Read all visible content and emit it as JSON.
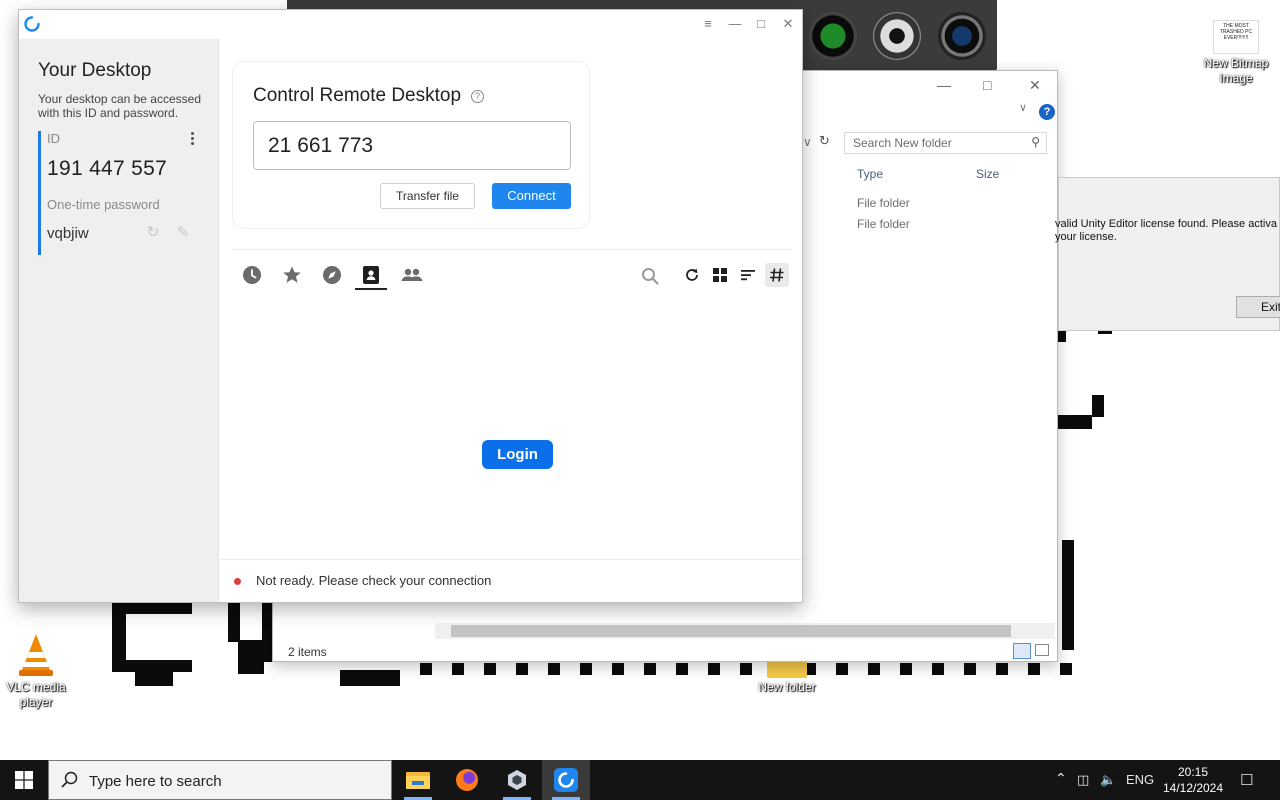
{
  "desktop": {
    "icons": [
      {
        "label": "New Bitmap Image",
        "thumb_caption": "THE MOST TRASHED PC EVER!!!!!!!!"
      },
      {
        "label": "VLC media player"
      },
      {
        "label": "New folder"
      }
    ]
  },
  "explorer": {
    "search_placeholder": "Search New folder",
    "columns": [
      "Type",
      "Size"
    ],
    "rows": [
      {
        "type": "File folder"
      },
      {
        "type": "File folder"
      }
    ],
    "status": "2 items"
  },
  "unity_dialog": {
    "message": "valid Unity Editor license found. Please activa your license.",
    "exit_label": "Exit"
  },
  "rustdesk": {
    "left": {
      "title": "Your Desktop",
      "description": "Your desktop can be accessed with this ID and password.",
      "id_label": "ID",
      "id_value": "191 447 557",
      "password_label": "One-time password",
      "password_value": "vqbjiw"
    },
    "connect": {
      "title": "Control Remote Desktop",
      "remote_id_value": "21 661 773",
      "transfer_label": "Transfer file",
      "connect_label": "Connect"
    },
    "tabs": [
      "recent-sessions",
      "favorites",
      "discovered",
      "address-book",
      "group"
    ],
    "active_tab": "address-book",
    "login_label": "Login",
    "status": {
      "text": "Not ready. Please check your connection",
      "color": "#dc3f3f"
    }
  },
  "taskbar": {
    "search_placeholder": "Type here to search",
    "language": "ENG",
    "time": "20:15",
    "date": "14/12/2024"
  },
  "colors": {
    "accent": "#1f86ee",
    "login": "#0a6fe8",
    "status_error": "#dc3f3f"
  }
}
